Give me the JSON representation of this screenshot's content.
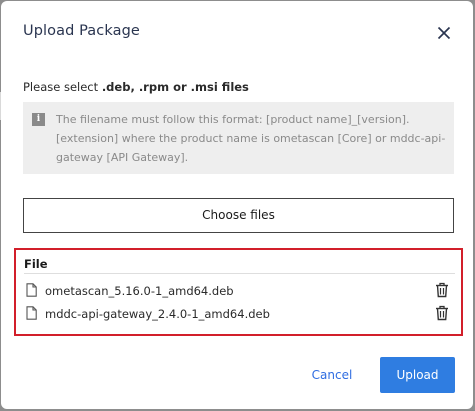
{
  "dialog": {
    "title": "Upload Package",
    "close_icon": "close-icon"
  },
  "hint": {
    "prefix": "Please select ",
    "formats": ".deb, .rpm or .msi files"
  },
  "info": {
    "icon": "info-icon",
    "icon_glyph": "i",
    "text": "The filename must follow this format: [product name]_[version].[extension] where the product name is ometascan [Core] or mddc-api-gateway [API Gateway]."
  },
  "choose_button": {
    "label": "Choose files"
  },
  "file_list": {
    "header": "File",
    "items": [
      {
        "name": "ometascan_5.16.0-1_amd64.deb",
        "icon": "document-icon",
        "delete_icon": "trash-icon"
      },
      {
        "name": "mddc-api-gateway_2.4.0-1_amd64.deb",
        "icon": "document-icon",
        "delete_icon": "trash-icon"
      }
    ],
    "highlight_color": "#d21f2a"
  },
  "footer": {
    "cancel_label": "Cancel",
    "upload_label": "Upload"
  },
  "colors": {
    "primary": "#2f7de1",
    "title": "#2a3550"
  }
}
